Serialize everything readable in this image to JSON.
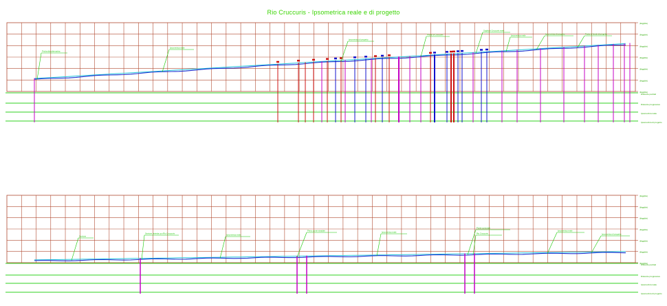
{
  "title": "Rio Cruccuris - Ipsometrica reale e di progetto",
  "colors": {
    "grid": "#b04a30",
    "row_lines": "#2fd21f",
    "terrain": "#1a2fd0",
    "design": "#26c6dc",
    "magenta": "#c400c4",
    "red": "#cc1010",
    "blue": "#1010cc",
    "label_green": "#16c800",
    "axis_text": "#2aa800"
  },
  "axis_labels": [
    "(illeggibile)"
  ],
  "top_panel": {
    "annotations": [
      "Profondita alternativa",
      "Ipsometrica reale",
      "Ipsometrica di progetto",
      "Profilo di Cruccuris",
      "Soglia di Cruccuris reale",
      "Ipsometrica reale",
      "Ipsometrica di progetto",
      "Tratto di fondo di progetto"
    ],
    "row_labels": [
      "Distanze parziali",
      "Distanze progressive",
      "Ipsometrica reale",
      "Ipsometrica di progetto"
    ]
  },
  "bottom_panel": {
    "annotations": [
      "Sezione",
      "Sezione ristretta con Rio Cruccuris",
      "Ipsometrica reale",
      "Primo ponte stradale",
      "Ipsometrica reale",
      "Ponte comunale",
      "Rio Cruccuris",
      "Ipsometrica reale",
      "Ipsometrica di progetto"
    ],
    "row_labels": [
      "Distanze parziali",
      "Distanze progressive",
      "Ipsometrica reale",
      "Ipsometrica di progetto"
    ]
  },
  "note": "Le scritte minute del disegno originale (quote, distanze e annotazioni) non sono leggibili alla risoluzione della schermata."
}
